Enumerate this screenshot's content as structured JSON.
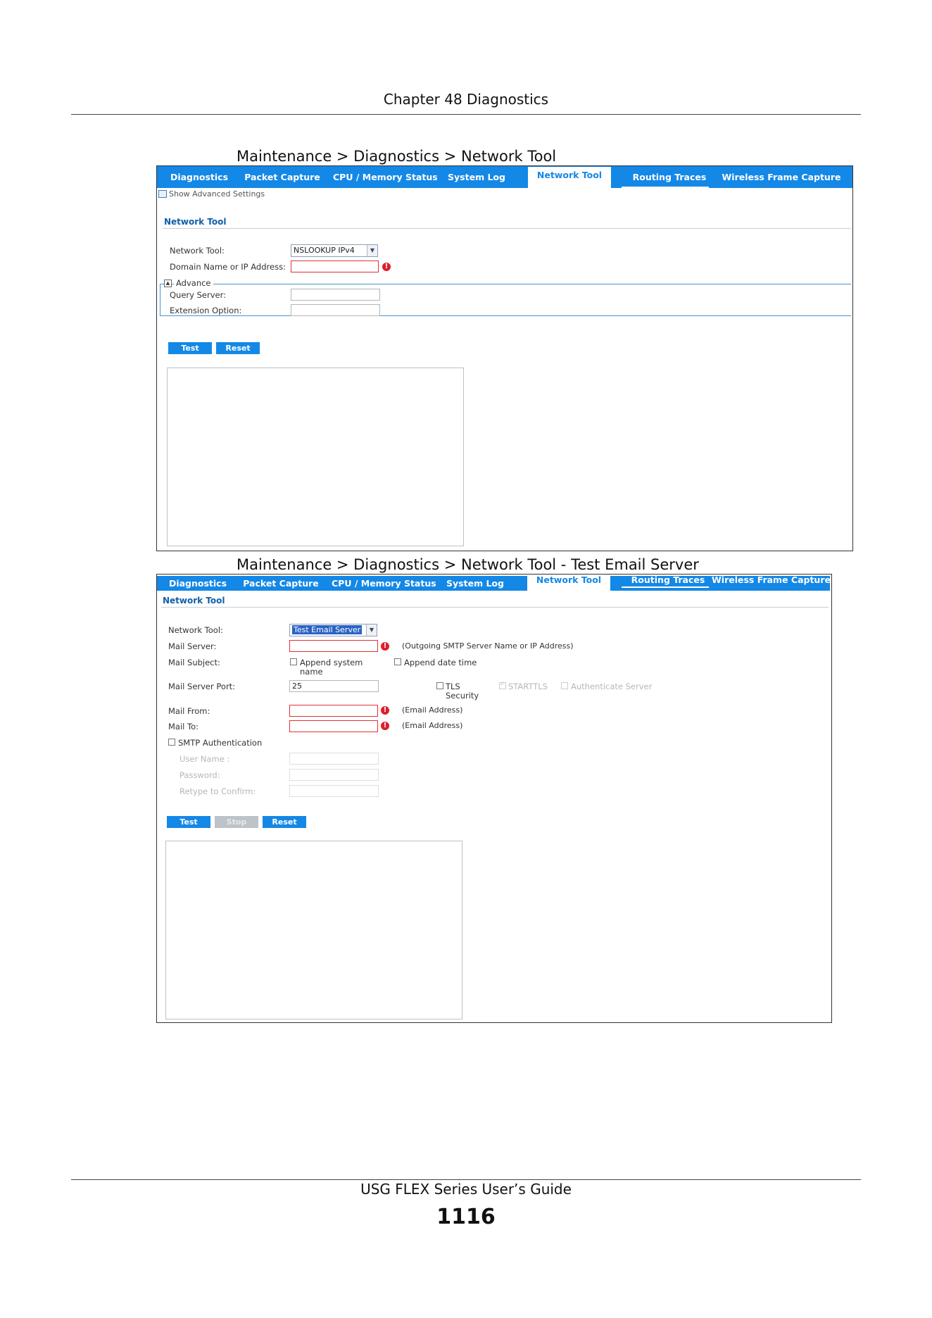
{
  "page_header": "Chapter 48 Diagnostics",
  "figure1": {
    "caption": "Maintenance > Diagnostics > Network Tool",
    "tabs": [
      "Diagnostics",
      "Packet Capture",
      "CPU / Memory Status",
      "System Log",
      "Network Tool",
      "Routing Traces",
      "Wireless Frame Capture"
    ],
    "active_tab": "Network Tool",
    "show_advanced": "Show Advanced Settings",
    "section_title": "Network Tool",
    "network_tool_label": "Network Tool:",
    "network_tool_value": "NSLOOKUP IPv4",
    "domain_label": "Domain Name or IP Address:",
    "domain_value": "",
    "advance_label": "Advance",
    "query_server_label": "Query Server:",
    "extension_option_label": "Extension Option:",
    "test_button": "Test",
    "reset_button": "Reset"
  },
  "figure2": {
    "caption": "Maintenance > Diagnostics > Network Tool - Test Email Server",
    "tabs": [
      "Diagnostics",
      "Packet Capture",
      "CPU / Memory Status",
      "System Log",
      "Network Tool",
      "Routing Traces",
      "Wireless Frame Capture"
    ],
    "active_tab": "Network Tool",
    "section_title": "Network Tool",
    "network_tool_label": "Network Tool:",
    "network_tool_value": "Test Email Server",
    "mail_server_label": "Mail Server:",
    "mail_server_hint": "(Outgoing SMTP Server Name or IP Address)",
    "mail_subject_label": "Mail Subject:",
    "append_system_name_1": "Append system",
    "append_system_name_2": "name",
    "append_date_time": "Append date time",
    "mail_server_port_label": "Mail Server Port:",
    "mail_server_port_value": "25",
    "tls_security_1": "TLS",
    "tls_security_2": "Security",
    "starttls": "STARTTLS",
    "authenticate_server": "Authenticate Server",
    "mail_from_label": "Mail From:",
    "mail_from_hint": "(Email Address)",
    "mail_to_label": "Mail To:",
    "mail_to_hint": "(Email Address)",
    "smtp_auth_label": "SMTP Authentication",
    "user_name_label": "User Name :",
    "password_label": "Password:",
    "retype_label": "Retype to Confirm:",
    "test_button": "Test",
    "stop_button": "Stop",
    "reset_button": "Reset"
  },
  "footer": {
    "guide_title": "USG FLEX Series User’s Guide",
    "page_number": "1116"
  }
}
